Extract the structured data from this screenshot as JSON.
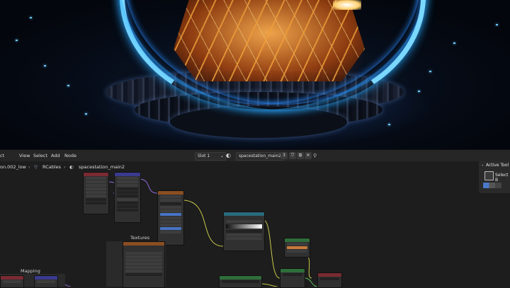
{
  "header": {
    "menu": [
      "ct",
      "View",
      "Select",
      "Add",
      "Node"
    ],
    "slot": "Slot 1",
    "material": "spacestation_main2",
    "user_count": "3"
  },
  "breadcrumb": {
    "object": "on.002_low",
    "mesh": "RCables",
    "material": "spacestation_main2"
  },
  "tool_panel": {
    "title": "Active Tool",
    "tool": "Select B"
  },
  "frames": {
    "textures": "Textures",
    "mapping": "Mapping"
  },
  "icons": {
    "slot": "chevron-down-icon",
    "material": "sphere-material-icon",
    "mesh": "mesh-icon",
    "fake_user": "shield-icon",
    "new": "duplicate-icon",
    "close": "close-icon",
    "pin": "pin-icon"
  }
}
